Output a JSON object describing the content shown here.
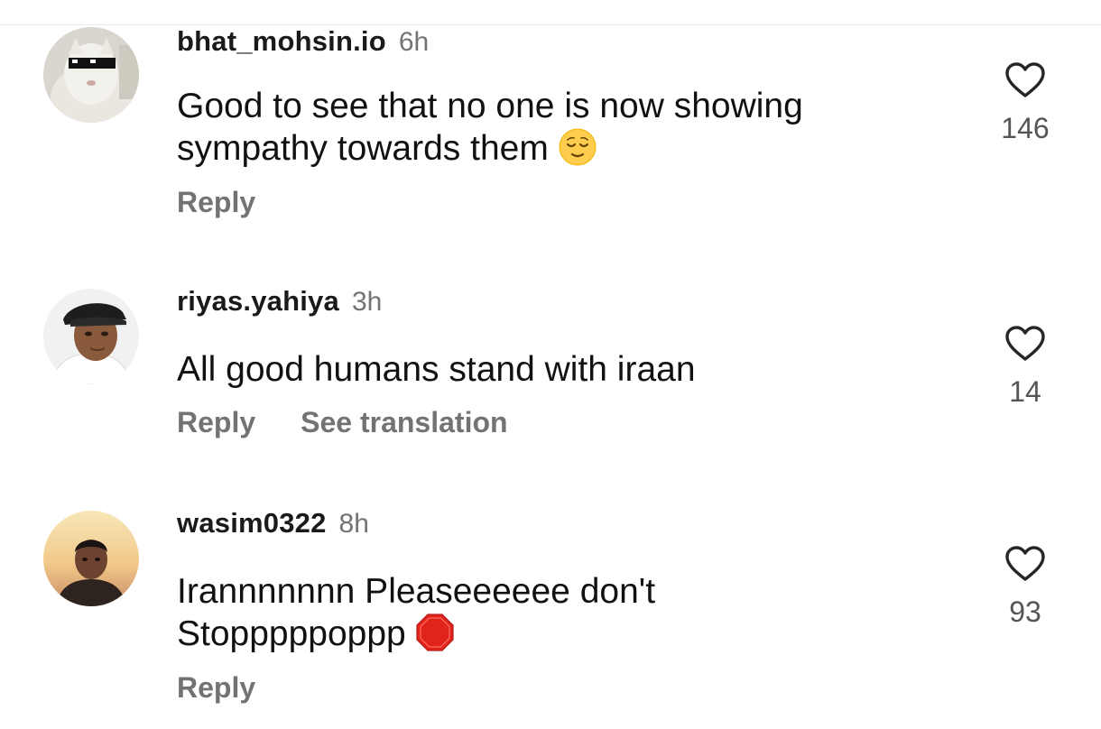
{
  "comments": [
    {
      "username": "bhat_mohsin.io",
      "time": "6h",
      "text": "Good to see that no one is now showing sympathy towards them",
      "emoji": "relieved-face",
      "likes": "146",
      "actions": [
        "Reply"
      ]
    },
    {
      "username": "riyas.yahiya",
      "time": "3h",
      "text": "All good humans stand with iraan",
      "likes": "14",
      "actions": [
        "Reply",
        "See translation"
      ]
    },
    {
      "username": "wasim0322",
      "time": "8h",
      "text": "Irannnnnnn Pleaseeeeee don't Stopppppoppp",
      "emoji": "stop-sign",
      "likes": "93",
      "actions": [
        "Reply"
      ]
    }
  ],
  "icons": {
    "like": "heart-outline-icon"
  },
  "colors": {
    "secondary_text": "#737373",
    "primary_text": "#111111"
  }
}
